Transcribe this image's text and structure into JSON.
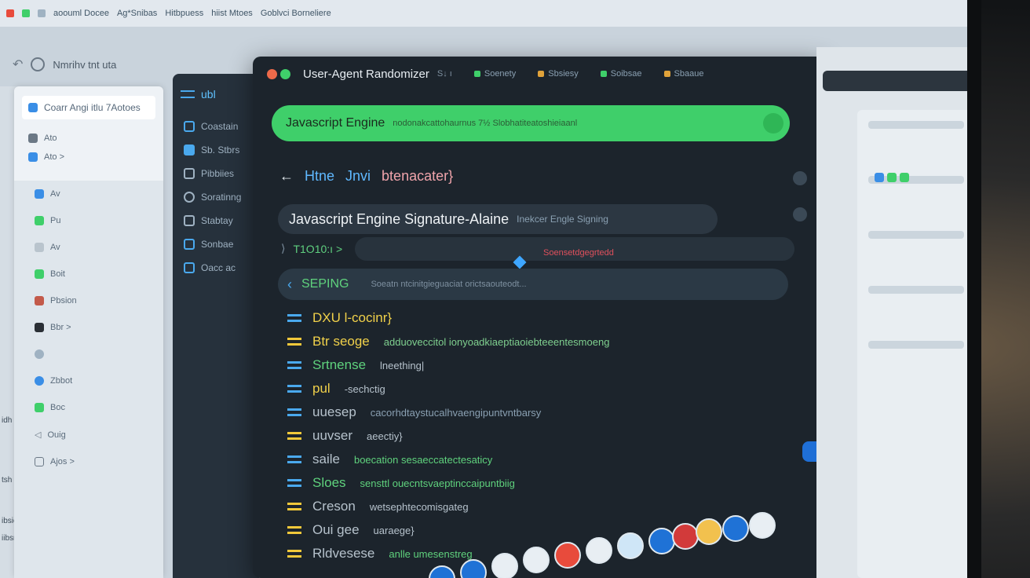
{
  "os_bar": {
    "title_items": [
      "aoouml Docee",
      "Ag*Snibas",
      "Hitbpuess",
      "hiist Mtoes",
      "Goblvci Borneliere"
    ]
  },
  "toolbar2": {
    "label": "Nmrihv tnt uta"
  },
  "finder": {
    "search_label": "Coarr Angi itlu 7Aotoes",
    "top_items": [
      {
        "icon": "folder-icon",
        "label": "Ato"
      },
      {
        "icon": "file-icon",
        "label": "Ato  >"
      }
    ],
    "side_items": [
      {
        "icon": "share-icon",
        "label": "Av"
      },
      {
        "icon": "share-icon",
        "label": "Pu"
      },
      {
        "icon": "file-icon",
        "label": "Av"
      },
      {
        "icon": "app-icon",
        "label": "Boit"
      },
      {
        "icon": "user-icon",
        "label": "Pbsion"
      },
      {
        "icon": "user-icon",
        "label": "Bbr >"
      },
      {
        "icon": "clock-icon",
        "label": ""
      },
      {
        "icon": "globe-icon",
        "label": "Zbbot"
      },
      {
        "icon": "folder-icon",
        "label": "Boc"
      },
      {
        "icon": "triangle-icon",
        "label": "Ouig"
      },
      {
        "icon": "file-icon",
        "label": "Ajos >"
      }
    ]
  },
  "left_edge_labels": [
    "idh",
    "tsh",
    "ibsion",
    "iibsm",
    "-"
  ],
  "nav": {
    "head_label": "ubl",
    "items": [
      {
        "icon": "list-icon",
        "label": "Coastain"
      },
      {
        "icon": "square-icon",
        "label": "Sb. Stbrs"
      },
      {
        "icon": "flag-icon",
        "label": "Pibbiies"
      },
      {
        "icon": "circle-icon",
        "label": "Soratinng"
      },
      {
        "icon": "grid-icon",
        "label": "Stabtay"
      },
      {
        "icon": "square-icon",
        "label": "Sonbae"
      },
      {
        "icon": "shield-icon",
        "label": "Oacc ac"
      }
    ]
  },
  "app": {
    "title": "User-Agent Randomizer",
    "title_suffix": "S↓ ı",
    "toolbar_items": [
      {
        "label": "Soenety",
        "color": "#3fcf6a"
      },
      {
        "label": "Sbsiesy",
        "color": "#e0a23a"
      },
      {
        "label": "Soibsae",
        "color": "#3fcf6a"
      },
      {
        "label": "Sbaaue",
        "color": "#e0a23a"
      }
    ],
    "colors": {
      "close": "#ee6a4a",
      "min": "#3fcf6a",
      "accent": "#3fcf6a",
      "blue": "#4aa9ee",
      "yellow": "#f1c83a"
    },
    "banner": {
      "text": "Javascript Engine",
      "extra": "nodonakcattohaurnus 7½ Slobhatiteatoshieiaanl"
    },
    "back_row": {
      "main": "Htne",
      "sub1": "Jnvi",
      "sub2": "btenacater}"
    },
    "signature_bar": {
      "text": "Javascript Engine Signature-Alaine",
      "tag": "Inekcer Engle Signing"
    },
    "time_row": {
      "label": "T1O10:ı >"
    },
    "red_chip": "Soensetdgegrtedd",
    "seping": {
      "label": "SEPING",
      "sub": "Soeatn ntcinitgieguaciat orictsaouteodt..."
    },
    "list": [
      {
        "color": "#4aa9ee",
        "label": "DXU l-cocinr}",
        "label_color": "#f1d14a",
        "desc": ""
      },
      {
        "color": "#f1c83a",
        "label": "Btr seoge",
        "label_color": "#f1d14a",
        "desc": "adduoveccitol ionyoadkiaeptiaoiebteeentesmoeng"
      },
      {
        "color": "#4aa9ee",
        "label": "Srtnense",
        "label_color": "#5fd27d",
        "desc": "lneething|"
      },
      {
        "color": "#4aa9ee",
        "label": "pul",
        "label_color": "#f1d14a",
        "desc": "-sechctig"
      },
      {
        "color": "#4aa9ee",
        "label": "uuesep",
        "label_color": "#b6c2cc",
        "desc": "cacorhdtaystucalhvaengipuntvntbarsy"
      },
      {
        "color": "#f1c83a",
        "label": "uuvser",
        "label_color": "#b6c2cc",
        "desc": "aeectiy}"
      },
      {
        "color": "#4aa9ee",
        "label": "saile",
        "label_color": "#b6c2cc",
        "desc": "boecation sesaeccatectesaticy"
      },
      {
        "color": "#4aa9ee",
        "label": "Sloes",
        "label_color": "#5fd27d",
        "desc": "sensttl ouecntsvaeptinccaipuntbiig"
      },
      {
        "color": "#f1c83a",
        "label": "Creson",
        "label_color": "#b6c2cc",
        "desc": "wetsephtecomisgateg"
      },
      {
        "color": "#f1c83a",
        "label": "Oui gee",
        "label_color": "#b6c2cc",
        "desc": "uaraege}"
      },
      {
        "color": "#f1c83a",
        "label": "Rldvesese",
        "label_color": "#b6c2cc",
        "desc": "anlle umesenstreg"
      }
    ]
  },
  "dock": {
    "icons": [
      "finder-icon",
      "users-icon",
      "store-icon",
      "photos-icon",
      "chrome-icon",
      "safari-icon",
      "globe-icon",
      "app-icon",
      "record-icon",
      "notes-icon",
      "mail-icon",
      "settings-icon"
    ],
    "colors": [
      "#1f72d6",
      "#1f72d6",
      "#e8eef3",
      "#e8eef3",
      "#e84b3c",
      "#e8eef3",
      "#cfe6f7",
      "#1f72d6",
      "#d23a3a",
      "#f2c14e",
      "#1f72d6",
      "#e8eef3"
    ]
  }
}
